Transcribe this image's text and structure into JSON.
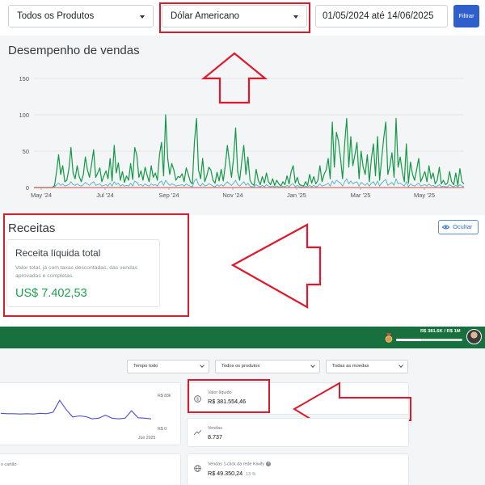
{
  "filters": {
    "product_select": "Todos os Produtos",
    "currency_select": "Dólar Americano",
    "date_range": "01/05/2024 até 14/06/2025",
    "filter_button": "Filtrar"
  },
  "sales_section": {
    "title": "Desempenho de vendas"
  },
  "chart_data": {
    "type": "line",
    "y_ticks": [
      "150",
      "100",
      "50",
      "0"
    ],
    "x_ticks": [
      "May '24",
      "Jul '24",
      "Sep '24",
      "Nov '24",
      "Jan '25",
      "Mar '25",
      "May '25"
    ],
    "ylim": [
      0,
      150
    ],
    "grid": true,
    "series": [
      {
        "color": "#119944",
        "values": [
          0,
          0,
          0,
          0,
          0,
          0,
          0,
          0,
          0,
          0,
          3,
          22,
          45,
          18,
          30,
          8,
          10,
          26,
          55,
          20,
          12,
          30,
          15,
          8,
          18,
          42,
          24,
          14,
          32,
          52,
          14,
          20,
          27,
          8,
          16,
          23,
          12,
          40,
          9,
          58,
          20,
          34,
          10,
          22,
          7,
          16,
          10,
          33,
          11,
          55,
          44,
          14,
          23,
          10,
          28,
          17,
          8,
          30,
          14,
          20,
          10,
          45,
          62,
          16,
          100,
          40,
          18,
          33,
          24,
          10,
          15,
          14,
          19,
          8,
          27,
          18,
          8,
          5,
          62,
          95,
          24,
          12,
          40,
          8,
          16,
          28,
          24,
          10,
          6,
          21,
          9,
          25,
          9,
          30,
          58,
          35,
          14,
          40,
          82,
          22,
          10,
          36,
          58,
          18,
          42,
          10,
          5,
          3,
          25,
          10,
          4,
          15,
          6,
          20,
          8,
          4,
          12,
          3,
          10,
          5,
          2,
          8,
          4,
          16,
          5,
          22,
          30,
          6,
          14,
          4,
          3,
          2,
          8,
          3,
          18,
          6,
          15,
          5,
          10,
          30,
          8,
          18,
          24,
          40,
          12,
          90,
          28,
          76,
          64,
          40,
          12,
          60,
          95,
          28,
          70,
          30,
          45,
          62,
          12,
          50,
          28,
          18,
          45,
          8,
          40,
          60,
          16,
          70,
          10,
          40,
          68,
          90,
          18,
          30,
          48,
          14,
          95,
          28,
          42,
          22,
          8,
          60,
          6,
          35,
          18,
          10,
          25,
          40,
          8,
          15,
          22,
          8,
          30,
          12,
          20,
          5,
          10,
          28,
          5,
          10,
          4,
          6,
          22,
          8,
          4,
          20,
          3,
          26,
          8,
          5
        ]
      },
      {
        "color": "#57b9c8",
        "values": [
          0,
          0,
          0,
          0,
          0,
          0,
          0,
          0,
          0,
          0,
          1,
          4,
          6,
          3,
          5,
          2,
          3,
          4,
          8,
          4,
          3,
          5,
          3,
          2,
          4,
          7,
          5,
          3,
          6,
          8,
          3,
          4,
          5,
          2,
          3,
          4,
          2,
          6,
          2,
          8,
          4,
          6,
          2,
          4,
          2,
          3,
          2,
          6,
          2,
          9,
          7,
          3,
          4,
          2,
          5,
          3,
          2,
          5,
          3,
          4,
          2,
          7,
          9,
          3,
          10,
          6,
          3,
          5,
          4,
          2,
          3,
          3,
          4,
          2,
          5,
          3,
          2,
          1,
          9,
          12,
          4,
          2,
          6,
          2,
          3,
          5,
          4,
          2,
          1,
          4,
          2,
          4,
          2,
          5,
          8,
          5,
          3,
          6,
          10,
          4,
          2,
          5,
          8,
          3,
          6,
          2,
          1,
          1,
          4,
          2,
          1,
          3,
          1,
          4,
          2,
          1,
          2,
          1,
          2,
          1,
          0,
          2,
          1,
          3,
          1,
          4,
          5,
          1,
          3,
          1,
          1,
          0,
          2,
          1,
          3,
          1,
          3,
          1,
          2,
          5,
          2,
          3,
          4,
          6,
          2,
          9,
          5,
          10,
          8,
          6,
          2,
          8,
          12,
          5,
          9,
          5,
          7,
          8,
          2,
          7,
          5,
          3,
          6,
          2,
          6,
          8,
          3,
          9,
          2,
          6,
          9,
          11,
          3,
          5,
          7,
          3,
          12,
          5,
          6,
          4,
          2,
          8,
          1,
          5,
          3,
          2,
          4,
          6,
          2,
          3,
          4,
          2,
          5,
          2,
          3,
          1,
          2,
          4,
          1,
          2,
          1,
          1,
          4,
          2,
          1,
          3,
          1,
          4,
          2,
          1
        ]
      },
      {
        "color": "#e04848",
        "values": [
          0,
          0,
          0,
          0,
          0,
          0,
          0,
          0,
          0,
          0,
          0,
          0,
          0,
          0,
          0,
          0,
          0,
          0,
          0,
          0,
          0,
          0,
          0,
          0,
          0,
          0,
          0,
          0,
          0,
          0,
          0,
          0,
          0,
          0,
          0,
          0,
          0,
          0,
          0,
          0,
          0,
          0,
          0,
          0,
          0,
          0,
          0,
          0,
          0,
          0,
          0,
          0,
          0,
          0,
          0,
          0,
          0,
          0,
          0,
          0,
          0,
          0,
          0,
          0,
          0,
          0,
          0,
          0,
          0,
          0,
          0,
          0,
          0,
          0,
          0,
          0,
          0,
          0,
          0,
          0,
          0,
          0,
          0,
          0,
          0,
          0,
          0,
          0,
          0,
          0,
          0,
          0,
          0,
          0,
          0,
          0,
          0,
          0,
          0,
          0,
          0,
          0,
          0,
          0,
          0,
          0,
          0,
          0,
          0,
          0,
          0,
          0,
          0,
          0,
          0,
          0,
          0,
          0,
          0,
          0,
          0,
          0,
          0,
          0,
          0,
          0,
          0,
          0,
          0,
          0,
          0,
          0,
          0,
          0,
          0,
          0,
          0,
          0,
          0,
          0,
          0,
          0,
          0,
          0,
          0,
          0,
          0,
          0,
          0,
          0,
          0,
          0,
          0,
          0,
          0,
          0,
          0,
          0,
          0,
          0,
          0,
          0,
          0,
          0,
          0,
          0,
          0,
          0,
          0,
          0,
          0,
          0,
          0,
          0,
          0,
          0,
          0,
          0,
          0,
          0,
          0,
          0,
          0,
          0,
          0,
          0,
          0,
          0,
          0,
          0,
          0,
          0,
          0,
          0,
          0,
          0,
          0,
          0,
          0,
          0,
          0,
          0,
          0,
          0,
          0,
          0,
          0,
          0,
          0,
          0,
          0
        ]
      }
    ]
  },
  "receitas": {
    "title": "Receitas",
    "hide_button": "Ocultar",
    "card_title": "Receita líquida total",
    "card_description": "Valor total, já com taxas descontadas, das vendas aprovadas e completas.",
    "card_value": "US$ 7.402,53"
  },
  "header": {
    "progress_label": "R$ 381.6K / R$ 1M",
    "progress_fraction": 0.382
  },
  "bottom_filters": {
    "period": "Tempo todo",
    "products": "Todos os produtos",
    "currencies": "Todas as moedas"
  },
  "mini_chart": {
    "top_value": "R$ 83k",
    "zero_value": "R$ 0",
    "x_label": "Jun 2025",
    "values": [
      45,
      44,
      44,
      43,
      44,
      43,
      45,
      44,
      48,
      80,
      55,
      35,
      38,
      36,
      30,
      32,
      40,
      32,
      30,
      32,
      52,
      33,
      32,
      30
    ]
  },
  "card_partial": {
    "label": "o cartão"
  },
  "stats": {
    "net_value_label": "Valor líquido",
    "net_value": "R$ 381.554,46",
    "sales_label": "Vendas",
    "sales": "8.737",
    "kiwify_label": "Vendas 1-click da rede Kiwify",
    "kiwify_value": "R$ 49.350,24",
    "kiwify_pct": "13 %",
    "info_glyph": "?"
  }
}
